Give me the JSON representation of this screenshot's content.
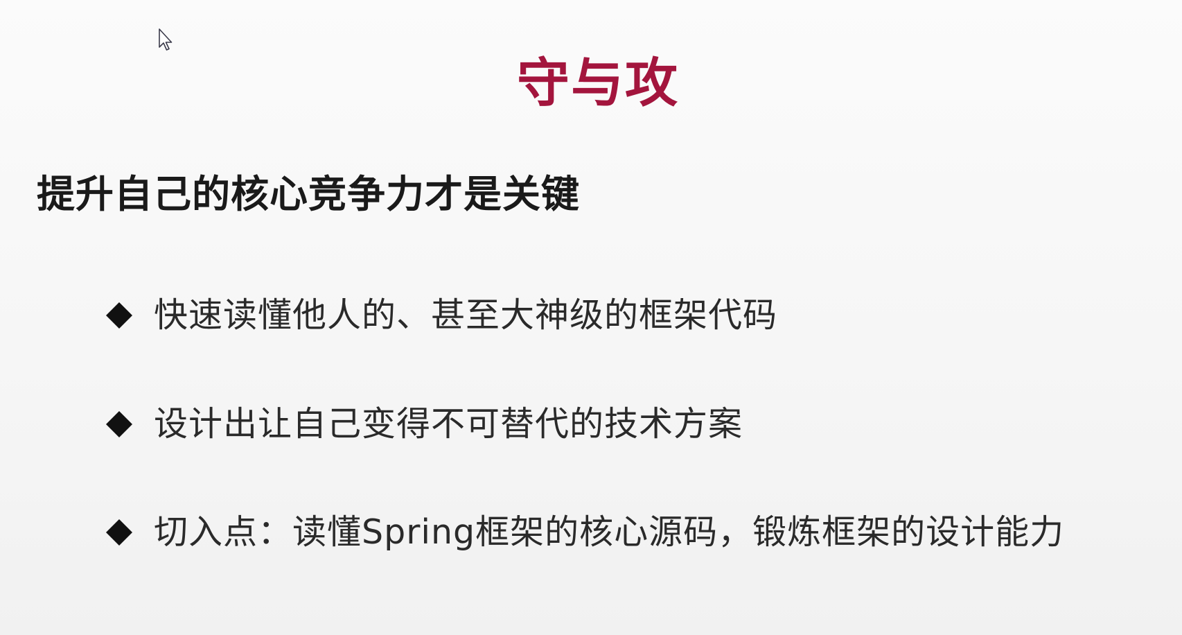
{
  "slide": {
    "title": "守与攻",
    "subtitle": "提升自己的核心竞争力才是关键",
    "bullets": [
      {
        "text": "快速读懂他人的、甚至大神级的框架代码"
      },
      {
        "text": "设计出让自己变得不可替代的技术方案"
      },
      {
        "text": "切入点：读懂Spring框架的核心源码，锻炼框架的设计能力"
      }
    ]
  },
  "colors": {
    "title": "#a3153d",
    "bullet_diamond": "#111111",
    "background": "#f7f7f7"
  },
  "icons": {
    "cursor": "mouse-pointer-icon",
    "bullet": "diamond-bullet-icon"
  }
}
